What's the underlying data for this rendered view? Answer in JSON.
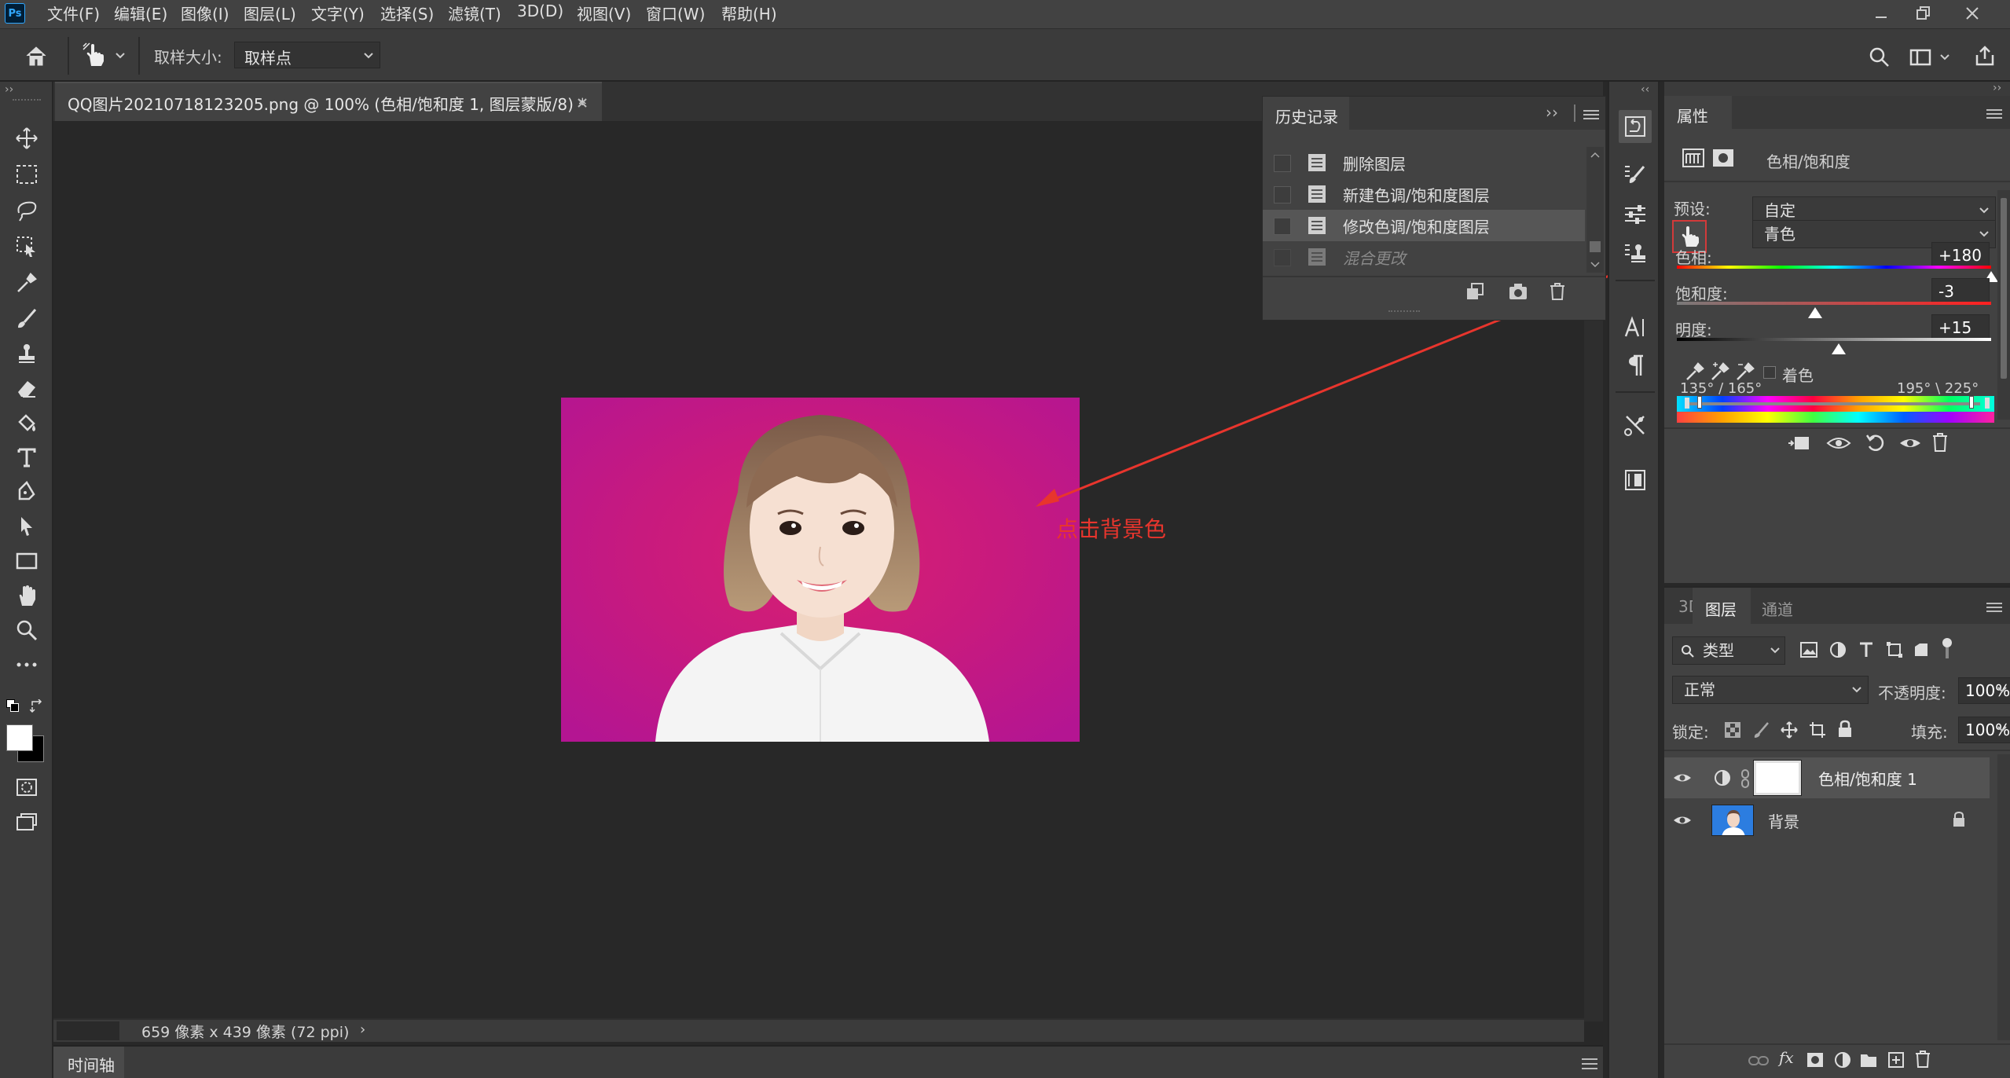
{
  "menu": {
    "app_icon": "Ps",
    "items": [
      "文件(F)",
      "编辑(E)",
      "图像(I)",
      "图层(L)",
      "文字(Y)",
      "选择(S)",
      "滤镜(T)",
      "3D(D)",
      "视图(V)",
      "窗口(W)",
      "帮助(H)"
    ]
  },
  "options": {
    "sample_size_label": "取样大小:",
    "sample_size_value": "取样点"
  },
  "document": {
    "tab_title": "QQ图片20210718123205.png @ 100% (色相/饱和度 1, 图层蒙版/8) *",
    "status_text": "659 像素 x 439 像素 (72 ppi)"
  },
  "annotation": {
    "text": "点击背景色",
    "color": "#e8352d"
  },
  "history": {
    "tab_label": "历史记录",
    "items": [
      {
        "label": "删除图层"
      },
      {
        "label": "新建色调/饱和度图层"
      },
      {
        "label": "修改色调/饱和度图层"
      },
      {
        "label": "混合更改"
      }
    ]
  },
  "properties": {
    "tab_label": "属性",
    "adjustment_name": "色相/饱和度",
    "preset_label": "预设:",
    "preset_value": "自定",
    "channel_value": "青色",
    "hue_label": "色相:",
    "hue_value": "+180",
    "saturation_label": "饱和度:",
    "saturation_value": "-3",
    "lightness_label": "明度:",
    "lightness_value": "+15",
    "colorize_label": "着色",
    "range_left": "135° / 165°",
    "range_right": "195° \\ 225°"
  },
  "layers": {
    "tabs": [
      "3D",
      "图层",
      "通道"
    ],
    "filter_label": "类型",
    "blend_mode": "正常",
    "opacity_label": "不透明度:",
    "opacity_value": "100%",
    "lock_label": "锁定:",
    "fill_label": "填充:",
    "fill_value": "100%",
    "items": [
      {
        "name": "色相/饱和度 1"
      },
      {
        "name": "背景"
      }
    ]
  },
  "timeline": {
    "label": "时间轴"
  },
  "colors": {
    "accent_photo_bg": "#c21a8e",
    "selected_tab": "#535353"
  }
}
